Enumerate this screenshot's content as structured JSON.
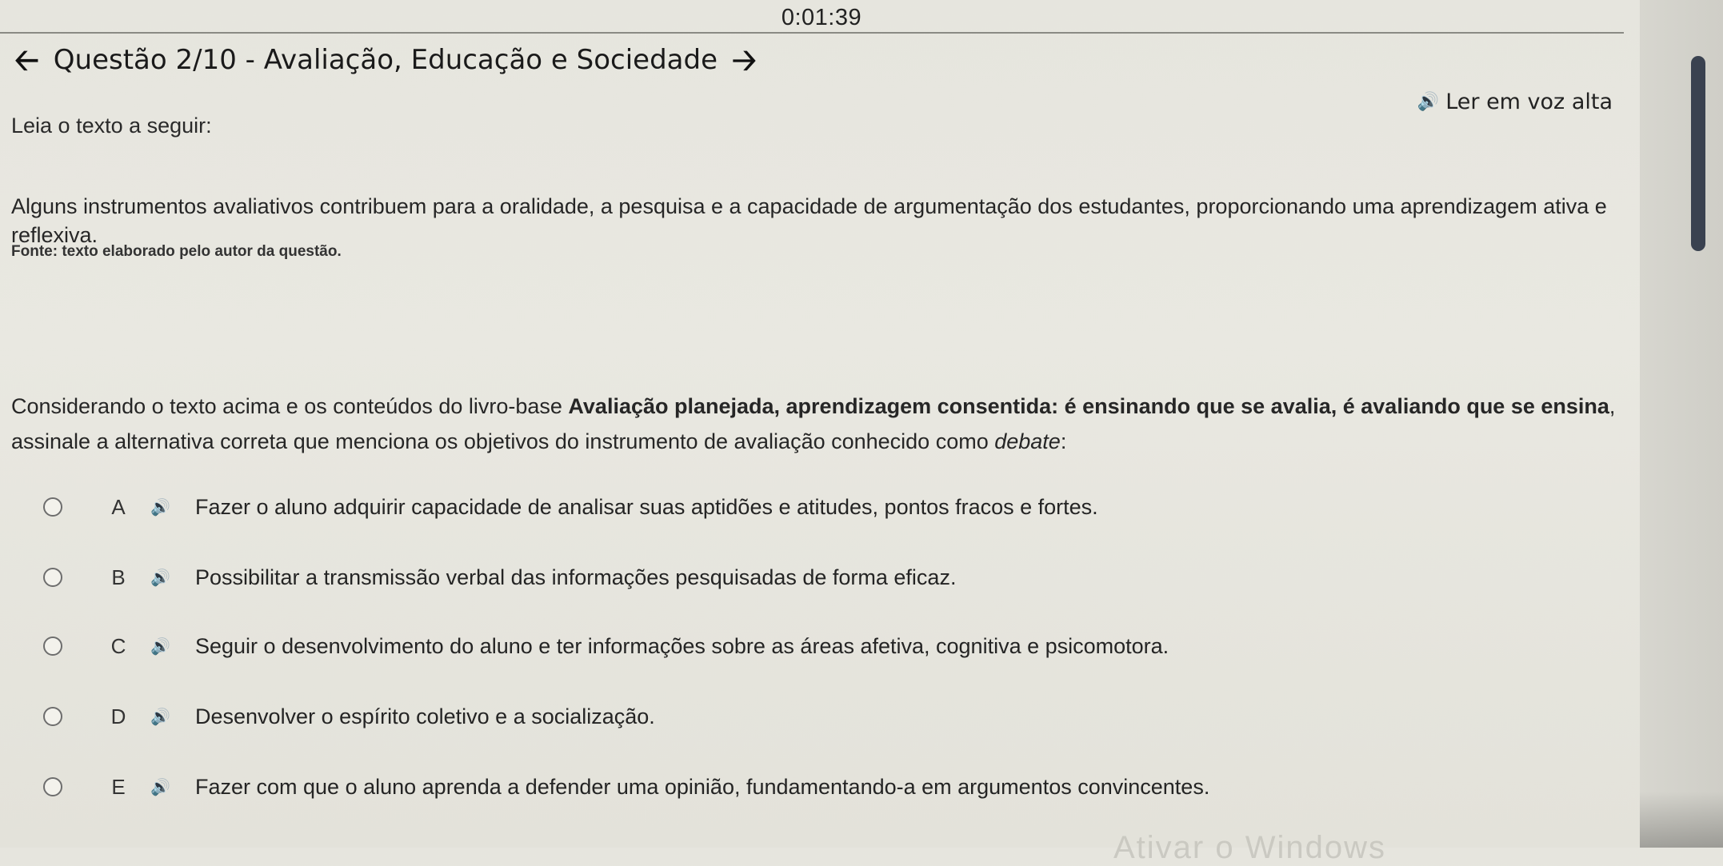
{
  "timer": "0:01:39",
  "header": {
    "title": "Questão 2/10 - Avaliação, Educação e Sociedade",
    "prev_icon": "arrow-left-icon",
    "next_icon": "arrow-right-icon"
  },
  "read_aloud": {
    "label": "Ler em voz alta",
    "icon": "speaker-icon"
  },
  "content": {
    "intro": "Leia o texto a seguir:",
    "paragraph": "Alguns instrumentos avaliativos contribuem para a oralidade, a pesquisa e a capacidade de argumentação dos estudantes, proporcionando uma aprendizagem ativa e reflexiva.",
    "source": "Fonte: texto elaborado pelo autor da questão.",
    "prompt_before": "Considerando o texto acima e os conteúdos do livro-base ",
    "prompt_book": "Avaliação planejada, aprendizagem consentida: é ensinando que se avalia, é avaliando que se ensina",
    "prompt_middle": ", assinale a alternativa correta que menciona os objetivos do instrumento de avaliação conhecido como ",
    "prompt_term": "debate",
    "prompt_end": ":"
  },
  "options": [
    {
      "letter": "A",
      "text": "Fazer o aluno adquirir capacidade de analisar suas aptidões e atitudes, pontos fracos e fortes."
    },
    {
      "letter": "B",
      "text": "Possibilitar a transmissão verbal das informações pesquisadas de forma eficaz."
    },
    {
      "letter": "C",
      "text": "Seguir o desenvolvimento do aluno e ter informações sobre as áreas afetiva, cognitiva e psicomotora."
    },
    {
      "letter": "D",
      "text": "Desenvolver o espírito coletivo e a socialização."
    },
    {
      "letter": "E",
      "text": "Fazer com que o aluno aprenda a defender uma opinião, fundamentando-a em argumentos convincentes."
    }
  ],
  "watermark": "Ativar o Windows",
  "colors": {
    "background": "#e6e5de",
    "scroll_thumb": "#3a4250",
    "text": "#1f1f1f"
  }
}
